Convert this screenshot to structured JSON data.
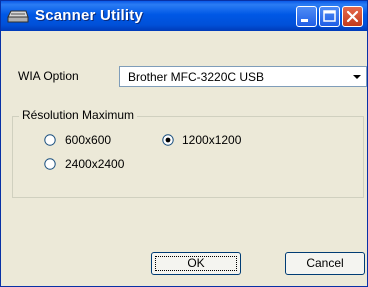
{
  "window": {
    "title": "Scanner Utility"
  },
  "wia": {
    "label": "WIA Option",
    "value": "Brother MFC-3220C USB"
  },
  "resolution": {
    "legend": "Résolution Maximum",
    "options": [
      "600x600",
      "1200x1200",
      "2400x2400"
    ],
    "selected": "1200x1200"
  },
  "buttons": {
    "ok": "OK",
    "cancel": "Cancel"
  }
}
